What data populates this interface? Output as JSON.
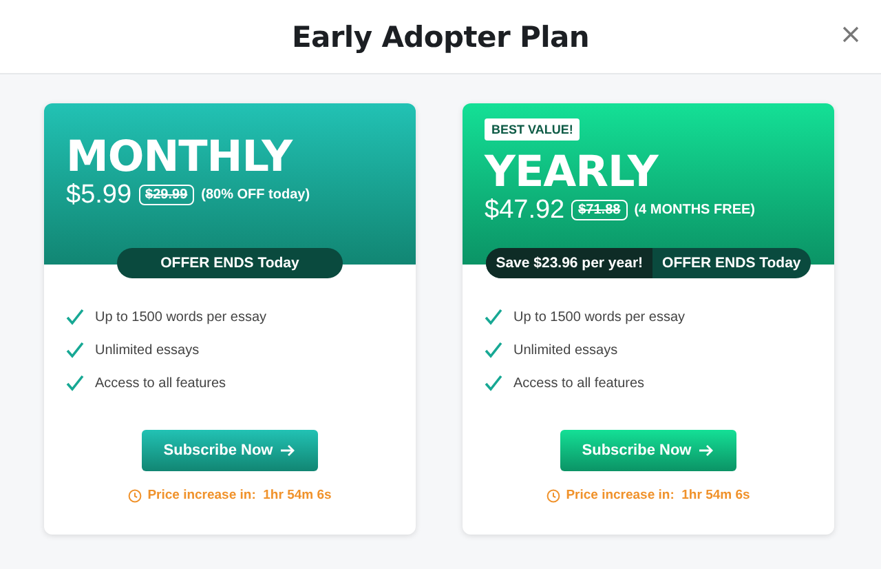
{
  "window": {
    "title": "Early Adopter Plan"
  },
  "plans": [
    {
      "name": "MONTHLY",
      "color": "#22c2b4",
      "price": "$5.99",
      "old_price": "$29.99",
      "note": "(80% OFF today)",
      "pill": [
        "OFFER ENDS Today"
      ],
      "features": [
        "Up to 1500 words per essay",
        "Unlimited essays",
        "Access to all features"
      ],
      "button": "Subscribe Now",
      "timer": "Price increase in:  1hr 54m 6s"
    },
    {
      "badge": "BEST VALUE!",
      "name": "YEARLY",
      "color": "#14e096",
      "price": "$47.92",
      "old_price": "$71.88",
      "note": "(4 MONTHS FREE)",
      "pill": [
        "Save $23.96 per year!",
        "OFFER ENDS Today"
      ],
      "features": [
        "Up to 1500 words per essay",
        "Unlimited essays",
        "Access to all features"
      ],
      "button": "Subscribe Now",
      "timer": "Price increase in:  1hr 54m 6s"
    }
  ]
}
